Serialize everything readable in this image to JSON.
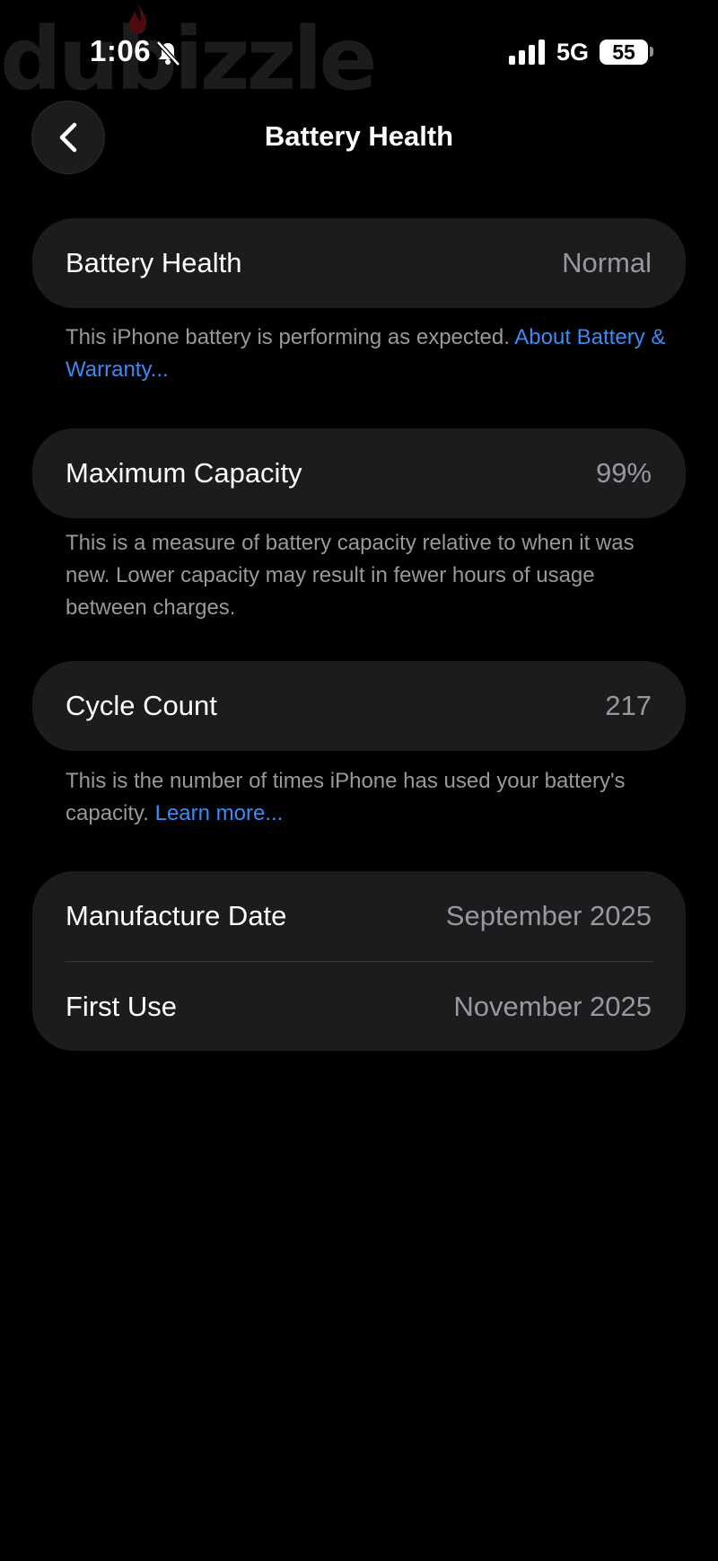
{
  "watermark": {
    "text": "dubizzle"
  },
  "status_bar": {
    "time": "1:06",
    "network": "5G",
    "battery_level": "55",
    "icons": [
      "bell-slash-icon",
      "signal-icon",
      "battery-icon"
    ]
  },
  "nav": {
    "title": "Battery Health",
    "back_icon": "chevron-left-icon"
  },
  "sections": {
    "health": {
      "label": "Battery Health",
      "value": "Normal",
      "note": "This iPhone battery is performing as expected. ",
      "note_link": "About Battery & Warranty..."
    },
    "capacity": {
      "label": "Maximum Capacity",
      "value": "99%",
      "note": "This is a measure of battery capacity relative to when it was new. Lower capacity may result in fewer hours of usage between charges."
    },
    "cycles": {
      "label": "Cycle Count",
      "value": "217",
      "note": "This is the number of times iPhone has used your battery's capacity. ",
      "note_link": "Learn more..."
    },
    "dates": {
      "manufacture_label": "Manufacture Date",
      "manufacture_value": "September 2025",
      "first_use_label": "First Use",
      "first_use_value": "November 2025"
    }
  },
  "colors": {
    "background": "#000000",
    "card": "#1c1c1e",
    "secondary_text": "#98989d",
    "link": "#3a8bf7"
  }
}
